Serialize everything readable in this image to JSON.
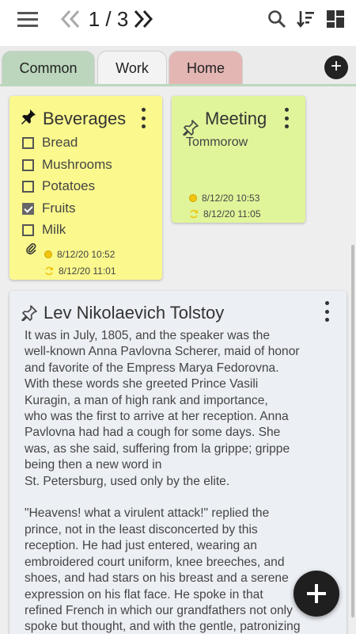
{
  "toolbar": {
    "page_indicator": "1 / 3",
    "icons": [
      "menu-icon",
      "double-chevron-left-icon",
      "double-chevron-right-icon",
      "search-icon",
      "sort-icon",
      "layout-icon"
    ]
  },
  "tabs": [
    {
      "label": "Common",
      "color": "#bcd6bd"
    },
    {
      "label": "Work",
      "color": "#f3f3f3"
    },
    {
      "label": "Home",
      "color": "#e3b6b4"
    }
  ],
  "add_tab_label": "+",
  "notes": {
    "beverages": {
      "title": "Beverages",
      "color": "#fbf98d",
      "items": [
        {
          "label": "Bread",
          "checked": false
        },
        {
          "label": "Mushrooms",
          "checked": false
        },
        {
          "label": "Potatoes",
          "checked": false
        },
        {
          "label": "Fruits",
          "checked": true
        },
        {
          "label": "Milk",
          "checked": false
        }
      ],
      "created": "8/12/20 10:52",
      "modified": "8/12/20 11:01"
    },
    "meeting": {
      "title": "Meeting",
      "color": "#e0f59a",
      "text": "Tommorow",
      "created": "8/12/20 10:53",
      "modified": "8/12/20 11:05"
    },
    "tolstoy": {
      "title": "Lev Nikolaevich Tolstoy",
      "color": "#eceff4",
      "text": "It was in July, 1805, and the speaker was the\nwell-known Anna Pavlovna Scherer, maid of honor\nand favorite of the Empress Marya Fedorovna.\nWith these words she greeted Prince Vasili\nKuragin, a man of high rank and importance,\nwho was the first to arrive at her reception. Anna\nPavlovna had had a cough for some days. She\nwas, as she said, suffering from la grippe; grippe\nbeing then a new word in\nSt. Petersburg, used only by the elite.\n\n\"Heavens! what a virulent attack!\" replied the\nprince, not in the least disconcerted by this\nreception. He had just entered, wearing an\nembroidered court uniform, knee breeches, and\nshoes, and had stars on his breast and a serene\nexpression on his flat face. He spoke in that\nrefined French in which our grandfathers not only\nspoke but thought, and with the gentle, patronizing"
    }
  },
  "fab_label": "+"
}
